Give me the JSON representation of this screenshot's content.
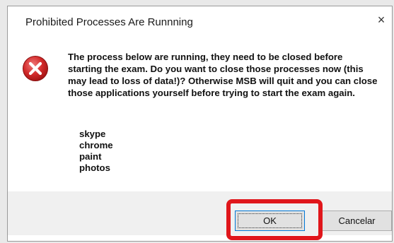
{
  "dialog": {
    "title": "Prohibited Processes Are Runnning",
    "close_glyph": "×",
    "icon": "error-icon",
    "message": "The process below are running, they need to be closed before starting the exam. Do you want to close those processes now (this may lead to loss of data!)? Otherwise MSB will quit and you can close those applications yourself before trying to start the exam again.",
    "processes": [
      "skype",
      "chrome",
      "paint",
      "photos"
    ],
    "buttons": {
      "ok_label": "OK",
      "cancel_label": "Cancelar"
    }
  },
  "colors": {
    "highlight": "#e0161b",
    "error_icon_red": "#d02020",
    "button_focus": "#0078d7"
  }
}
